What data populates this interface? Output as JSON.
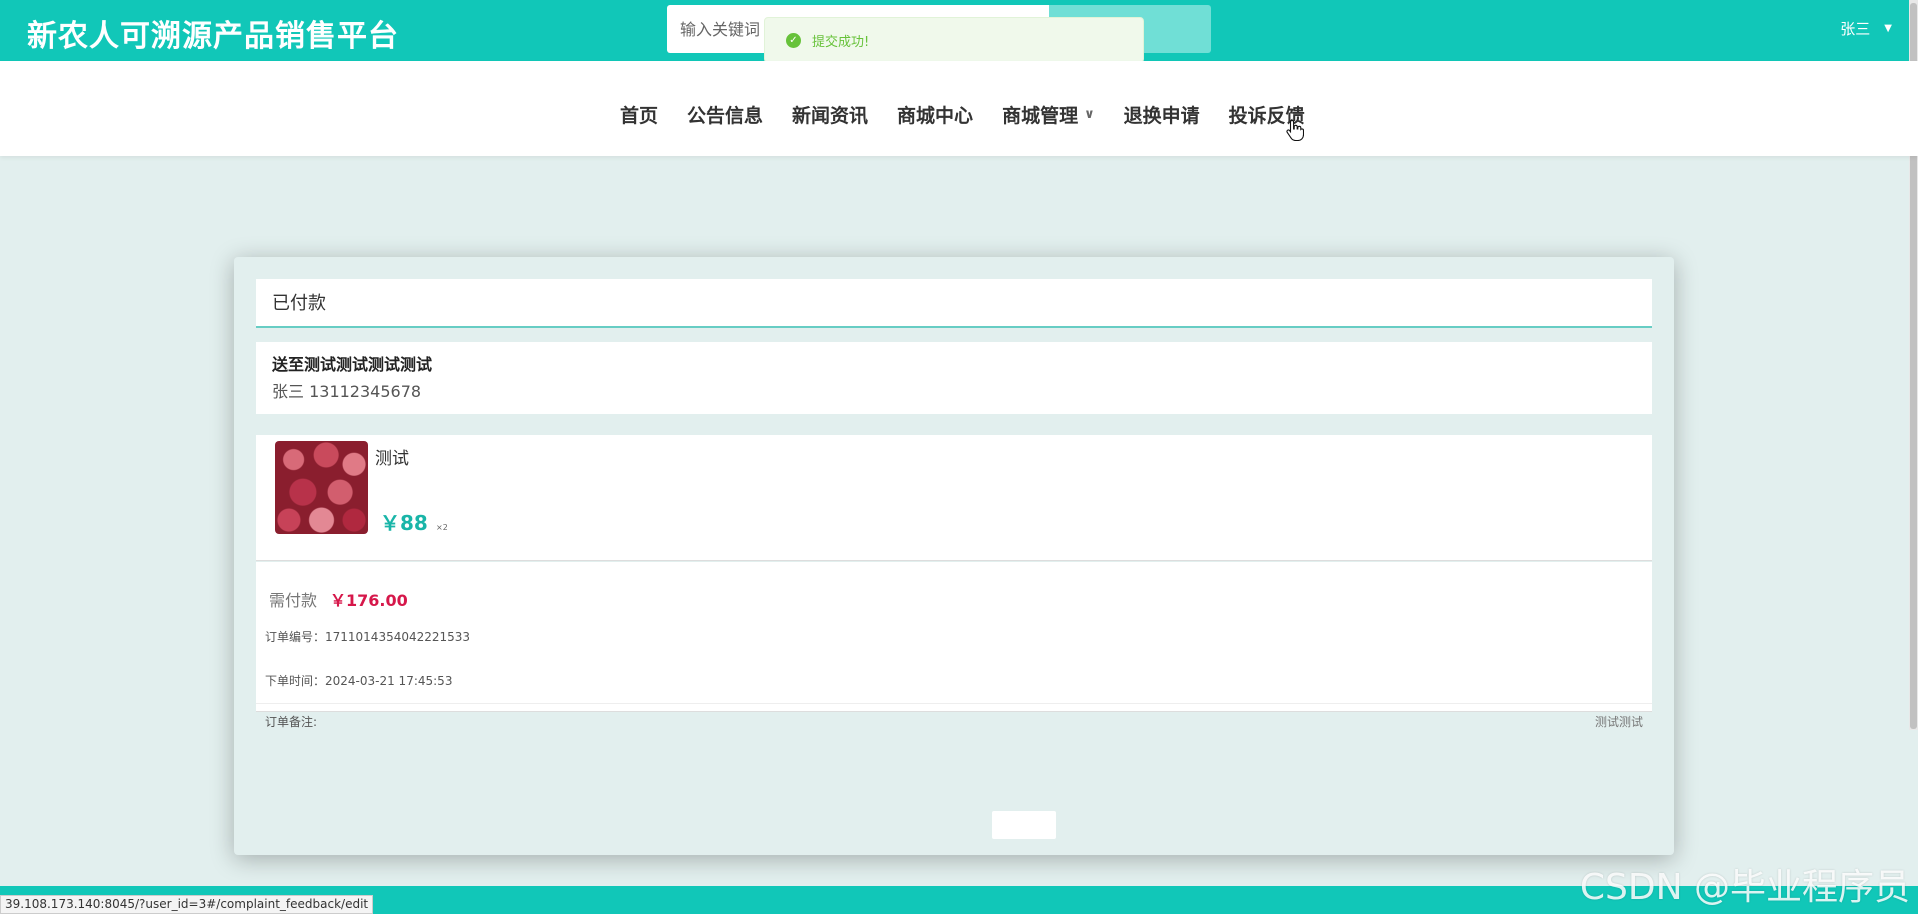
{
  "header": {
    "site_title": "新农人可溯源产品销售平台",
    "search_placeholder": "输入关键词",
    "user_name": "张三",
    "user_caret": "▼"
  },
  "toast": {
    "icon": "✓",
    "message": "提交成功!"
  },
  "nav": {
    "items": [
      {
        "label": "首页"
      },
      {
        "label": "公告信息"
      },
      {
        "label": "新闻资讯"
      },
      {
        "label": "商城中心"
      },
      {
        "label": "商城管理",
        "has_dropdown": true
      },
      {
        "label": "退换申请"
      },
      {
        "label": "投诉反馈"
      }
    ],
    "chevron": "∨"
  },
  "order": {
    "status": "已付款",
    "address": "送至测试测试测试测试",
    "contact": "张三 13112345678",
    "product": {
      "name": "测试",
      "price": "￥88",
      "quantity": "×2"
    },
    "pay_label": "需付款",
    "pay_amount": "￥176.00",
    "order_no": "订单编号：1711014354042221533",
    "order_time": "下单时间：2024-03-21 17:45:53",
    "note_label": "订单备注:",
    "note_value": "测试测试"
  },
  "status_url": "39.108.173.140:8045/?user_id=3#/complaint_feedback/edit",
  "watermark": "CSDN @毕业程序员",
  "colors": {
    "primary": "#11c7b8",
    "background": "#e2efee",
    "price": "#19b5a8",
    "pay_amount": "#d6174a",
    "toast_success": "#67c23a"
  }
}
